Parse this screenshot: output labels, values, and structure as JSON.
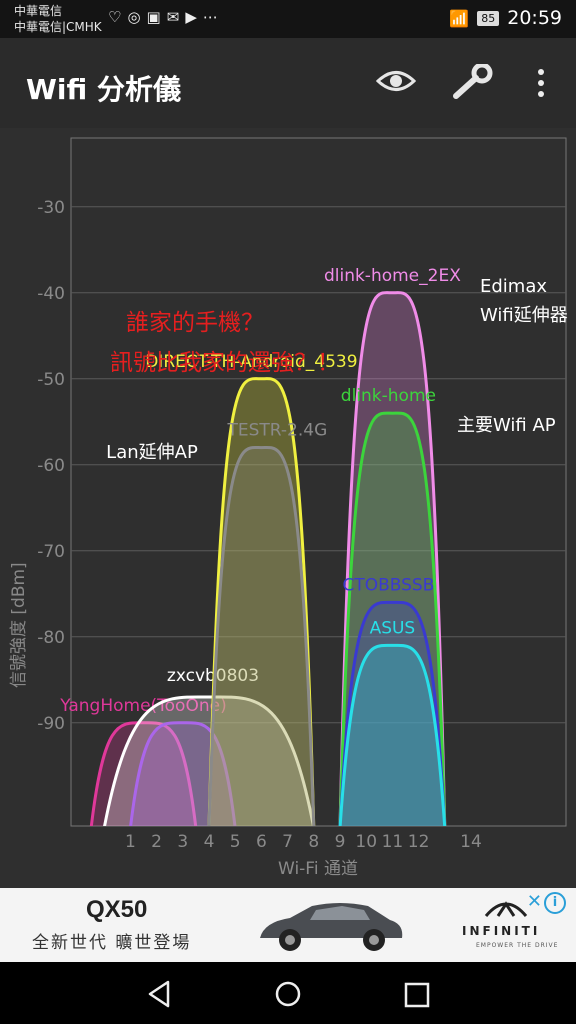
{
  "status_bar": {
    "carrier_1": "中華電信",
    "carrier_2": "中華電信|CMHK",
    "left_icons": [
      "heart-icon",
      "instagram-icon",
      "image-icon",
      "mail-icon",
      "play-store-icon",
      "more-dots-icon"
    ],
    "battery": "85",
    "time": "20:59"
  },
  "app_bar": {
    "title": "Wifi 分析儀",
    "icons": [
      "eye-icon",
      "wrench-icon",
      "overflow-menu-icon"
    ]
  },
  "chart_data": {
    "type": "area",
    "xlabel": "Wi-Fi 通道",
    "ylabel": "信號強度 [dBm]",
    "ylim": [
      -100,
      -20
    ],
    "yticks": [
      -30,
      -40,
      -50,
      -60,
      -70,
      -80,
      -90
    ],
    "x_ticks": [
      "1",
      "2",
      "3",
      "4",
      "5",
      "6",
      "7",
      "8",
      "9",
      "10",
      "11",
      "12",
      "14"
    ],
    "grid": true,
    "series": [
      {
        "name": "YangHome(TooOne)",
        "center": 1.5,
        "halfwidth": 2,
        "peak": -90,
        "color": "#e0389a"
      },
      {
        "name": "",
        "center": 3,
        "halfwidth": 2,
        "peak": -90,
        "color": "#8a2be2"
      },
      {
        "name": "zxcvb0803",
        "center": 4,
        "halfwidth": 4,
        "peak": -87,
        "color": "#ffffff"
      },
      {
        "name": "DIRECT-TH-Android_4539",
        "center": 6,
        "halfwidth": 2,
        "peak": -50,
        "color": "#f0f040"
      },
      {
        "name": "TESTR-2.4G",
        "center": 6,
        "halfwidth": 2,
        "peak": -58,
        "color": "#8a8a8a"
      },
      {
        "name": "dlink-home_2EX",
        "center": 11,
        "halfwidth": 2,
        "peak": -40,
        "color": "#f08ce8"
      },
      {
        "name": "dlink-home",
        "center": 11,
        "halfwidth": 2,
        "peak": -54,
        "color": "#3cd43c"
      },
      {
        "name": "CTOBBSSB",
        "center": 11,
        "halfwidth": 2,
        "peak": -76,
        "color": "#3a3ad0"
      },
      {
        "name": "ASUS",
        "center": 11,
        "halfwidth": 2,
        "peak": -81,
        "color": "#28dfe8"
      }
    ],
    "annotations": [
      {
        "text": "誰家的手機？",
        "color": "#e51f1f"
      },
      {
        "text": "訊號比我家的還強？！",
        "color": "#e51f1f"
      },
      {
        "text": "Lan延伸AP",
        "color": "#ffffff"
      },
      {
        "text": "Edimax",
        "color": "#ffffff"
      },
      {
        "text": "Wifi延伸器",
        "color": "#ffffff"
      },
      {
        "text": "主要Wifi AP",
        "color": "#ffffff"
      }
    ]
  },
  "ad": {
    "brand": "QX50",
    "subtitle": "全新世代 曠世登場",
    "logo": "INFINITI",
    "tagline": "EMPOWER THE DRIVE",
    "info_label": "i",
    "close_label": "✕"
  },
  "nav_bar": {
    "icons": [
      "back-icon",
      "home-icon",
      "recents-icon"
    ]
  }
}
